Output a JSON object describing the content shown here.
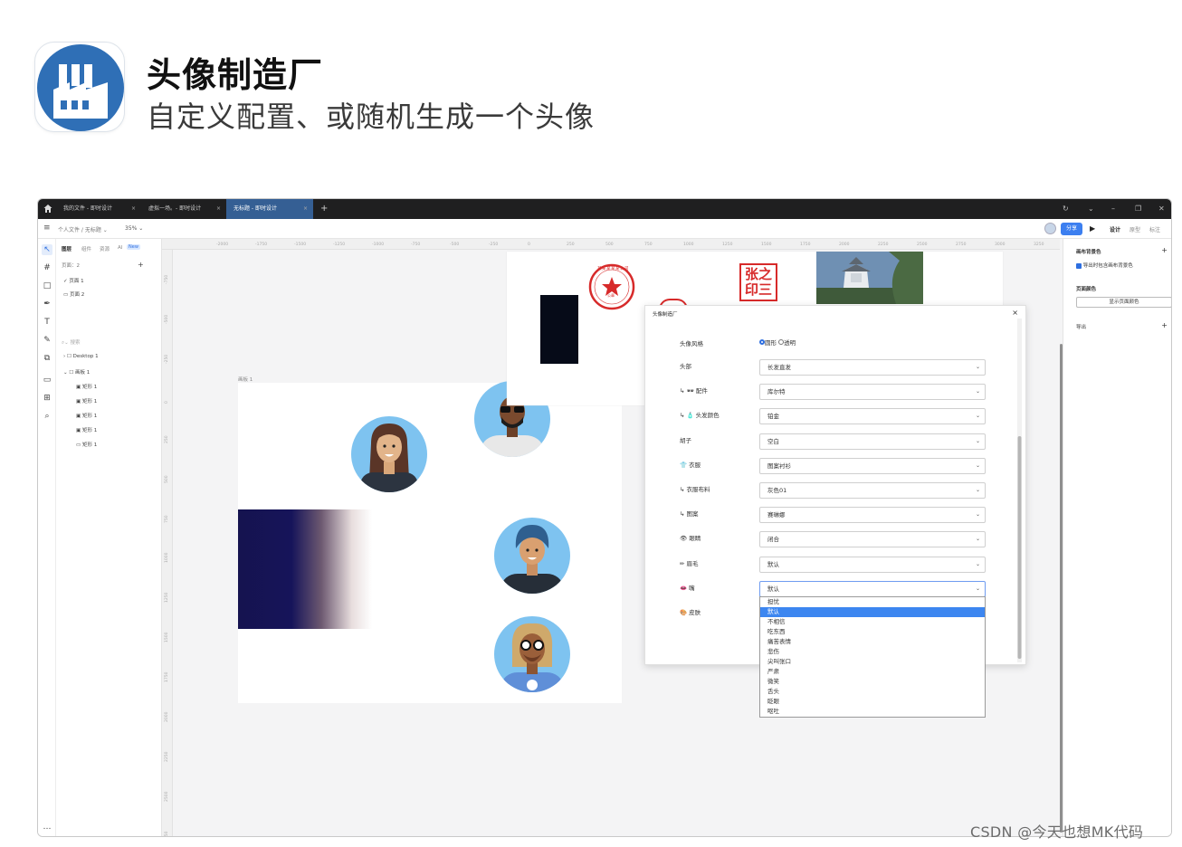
{
  "hero": {
    "title": "头像制造厂",
    "subtitle": "自定义配置、或随机生成一个头像",
    "icon": "factory-icon",
    "icon_bg": "#2f6fb6"
  },
  "window": {
    "tabs": [
      {
        "label": "我的文件 - 即时设计"
      },
      {
        "label": "虚拟一场。- 即时设计"
      },
      {
        "label": "无标题 - 即时设计",
        "active": true
      }
    ],
    "controls": {
      "refresh": "↻",
      "chevron": "⌄",
      "minimize": "–",
      "restore": "❐",
      "close": "✕"
    }
  },
  "toolbar": {
    "breadcrumb": "个人文件 / 无标题 ⌄",
    "zoom": "35% ⌄",
    "share": "分享",
    "modes": [
      "设计",
      "原型",
      "标注"
    ]
  },
  "layers_panel": {
    "tabs": [
      "图层",
      "组件",
      "资源",
      "AI"
    ],
    "new_badge": "New",
    "pages_header": "页面：2",
    "pages": [
      "页面 1",
      "页面 2"
    ],
    "search_placeholder": "搜索",
    "tree": [
      "Desktop 1",
      "画板 1",
      "矩形 1",
      "矩形 1",
      "矩形 1",
      "矩形 1",
      "矩形 1"
    ]
  },
  "ruler": {
    "top": [
      "-2000",
      "-1750",
      "-1500",
      "-1250",
      "-1000",
      "-750",
      "-500",
      "-250",
      "0",
      "250",
      "500",
      "750",
      "1000",
      "1250",
      "1500",
      "1750",
      "2000",
      "2250",
      "2500",
      "2750",
      "3000",
      "3250",
      "3500"
    ],
    "left": [
      "-750",
      "-500",
      "-250",
      "0",
      "250",
      "500",
      "750",
      "1000",
      "1250",
      "1500",
      "1750",
      "2000",
      "2250",
      "2500",
      "2750"
    ]
  },
  "canvas": {
    "frame_label": "画板 1"
  },
  "properties_panel": {
    "canvas_bg_title": "画布背景色",
    "export_bg_checkbox": "导出时包含画布背景色",
    "page_color_title": "页面颜色",
    "show_page_color_button": "显示页面颜色",
    "export_title": "导出"
  },
  "dialog": {
    "title": "头像制造厂",
    "style_label": "头像风格",
    "style_options": [
      "圆形",
      "透明"
    ],
    "fields": [
      {
        "label": "头部",
        "value": "长发直发"
      },
      {
        "label": "↳ 🕶 配件",
        "value": "库尔特"
      },
      {
        "label": "↳ 🧴 头发颜色",
        "value": "铂金"
      },
      {
        "label": "胡子",
        "value": "空白"
      },
      {
        "label": "👕 衣服",
        "value": "图案衬衫"
      },
      {
        "label": "↳ 衣服布料",
        "value": "灰色01"
      },
      {
        "label": "↳ 图案",
        "value": "赛琳娜"
      },
      {
        "label": "👁 眼睛",
        "value": "闭合"
      },
      {
        "label": "✏ 眉毛",
        "value": "默认"
      },
      {
        "label": "👄 嘴",
        "value": "默认"
      }
    ],
    "skin_label": "🎨 皮肤",
    "dropdown_options": [
      "担忧",
      "默认",
      "不相信",
      "吃东西",
      "痛苦表情",
      "悲伤",
      "尖叫张口",
      "严肃",
      "微笑",
      "舌头",
      "眨眼",
      "呕吐"
    ],
    "dropdown_selected": "默认"
  },
  "stamps": {
    "company_seal_text": "某某某某某公司",
    "seal_bottom": "公章",
    "name_seal": "张之印三"
  },
  "watermark": "CSDN @今天也想MK代码"
}
